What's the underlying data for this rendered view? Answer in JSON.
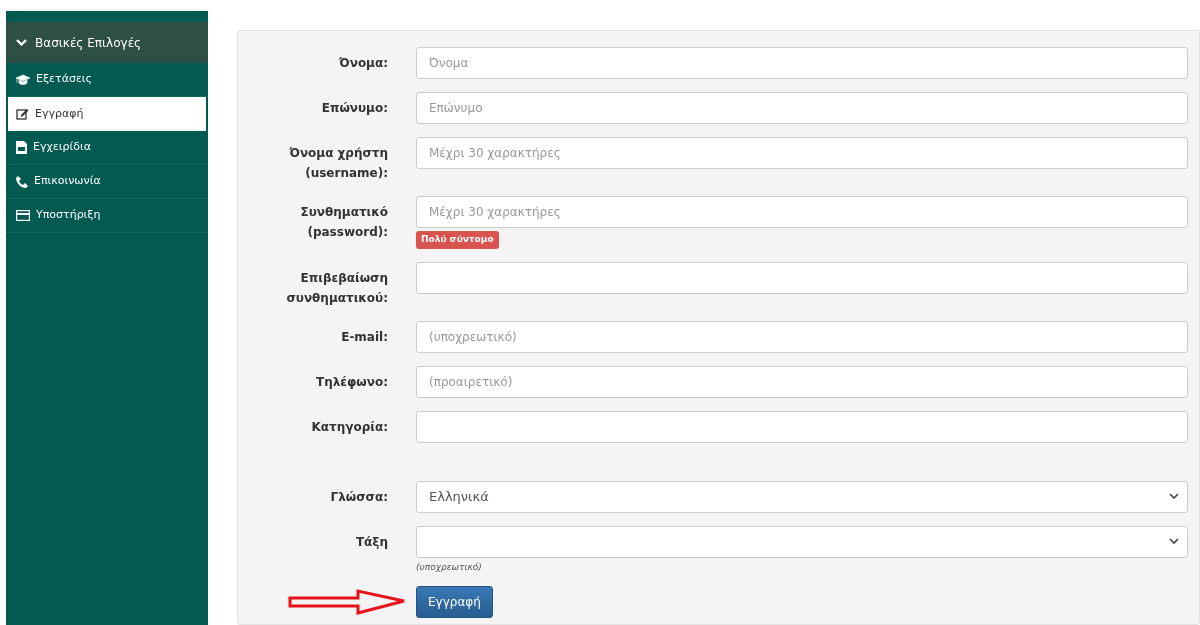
{
  "sidebar": {
    "header": {
      "label": "Βασικές Επιλογές",
      "expanded": true
    },
    "items": [
      {
        "label": "Εξετάσεις",
        "selected": false
      },
      {
        "label": "Εγγραφή",
        "selected": true
      },
      {
        "label": "Εγχειρίδια",
        "selected": false
      },
      {
        "label": "Επικοινωνία",
        "selected": false
      },
      {
        "label": "Υποστήριξη",
        "selected": false
      }
    ]
  },
  "form": {
    "fields": [
      {
        "kind": "text",
        "label": "Όνομα:",
        "placeholder": "Όνομα"
      },
      {
        "kind": "text",
        "label": "Επώνυμο:",
        "placeholder": "Επώνυμο"
      },
      {
        "kind": "text",
        "label": "Όνομα χρήστη (username):",
        "placeholder": "Μέχρι 30 χαρακτήρες"
      },
      {
        "kind": "text",
        "label": "Συνθηματικό (password):",
        "placeholder": "Μέχρι 30 χαρακτήρες",
        "error": "Πολύ σύντομο"
      },
      {
        "kind": "text",
        "label": "Επιβεβαίωση συνθηματικού:"
      },
      {
        "kind": "text",
        "label": "E-mail:",
        "placeholder": "(υποχρεωτικό)"
      },
      {
        "kind": "text",
        "label": "Τηλέφωνο:",
        "placeholder": "(προαιρετικό)"
      },
      {
        "kind": "text",
        "label": "Κατηγορία:"
      },
      {
        "kind": "select",
        "label": "Γλώσσα:",
        "value": "Ελληνικά"
      },
      {
        "kind": "select",
        "label": "Τάξη",
        "hint": "(υποχρεωτικό)"
      }
    ],
    "submit": "Εγγραφή"
  }
}
